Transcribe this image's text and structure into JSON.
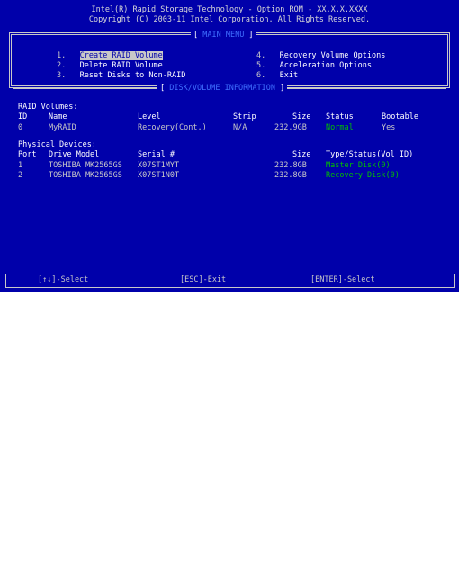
{
  "header": {
    "line1": "Intel(R) Rapid Storage Technology - Option ROM - XX.X.X.XXXX",
    "line2": "Copyright (C) 2003-11 Intel Corporation. All Rights Reserved."
  },
  "main_menu": {
    "title": "MAIN MENU",
    "items": [
      {
        "num": "1.",
        "label": "Create RAID Volume"
      },
      {
        "num": "2.",
        "label": "Delete RAID Volume"
      },
      {
        "num": "3.",
        "label": "Reset Disks to Non-RAID"
      },
      {
        "num": "4.",
        "label": "Recovery Volume Options"
      },
      {
        "num": "5.",
        "label": "Acceleration Options"
      },
      {
        "num": "6.",
        "label": "Exit"
      }
    ]
  },
  "disk_info": {
    "title": "DISK/VOLUME INFORMATION",
    "raid_volumes_label": "RAID Volumes:",
    "volume_headers": [
      "ID",
      "Name",
      "Level",
      "Strip",
      "Size",
      "Status",
      "Bootable"
    ],
    "volumes": [
      {
        "id": "0",
        "name": "MyRAID",
        "level": "Recovery(Cont.)",
        "strip": "N/A",
        "size": "232.9GB",
        "status": "Normal",
        "bootable": "Yes"
      }
    ],
    "physical_label": "Physical Devices:",
    "device_headers": [
      "Port",
      "Drive Model",
      "Serial #",
      "Size",
      "Type/Status(Vol ID)"
    ],
    "devices": [
      {
        "port": "1",
        "model": "TOSHIBA MK2565GS",
        "serial": "X07ST1MYT",
        "size": "232.8GB",
        "type_status": "Master Disk(0)"
      },
      {
        "port": "2",
        "model": "TOSHIBA MK2565GS",
        "serial": "X07ST1N0T",
        "size": "232.8GB",
        "type_status": "Recovery Disk(0)"
      }
    ]
  },
  "footer": {
    "select": "[↑↓]-Select",
    "exit": "[ESC]-Exit",
    "enter": "[ENTER]-Select"
  },
  "colors": {
    "background": "#0000aa",
    "text": "#c8c8c8",
    "highlight": "#ffffff",
    "section_title": "#3f6fff",
    "status_ok": "#00c000"
  }
}
